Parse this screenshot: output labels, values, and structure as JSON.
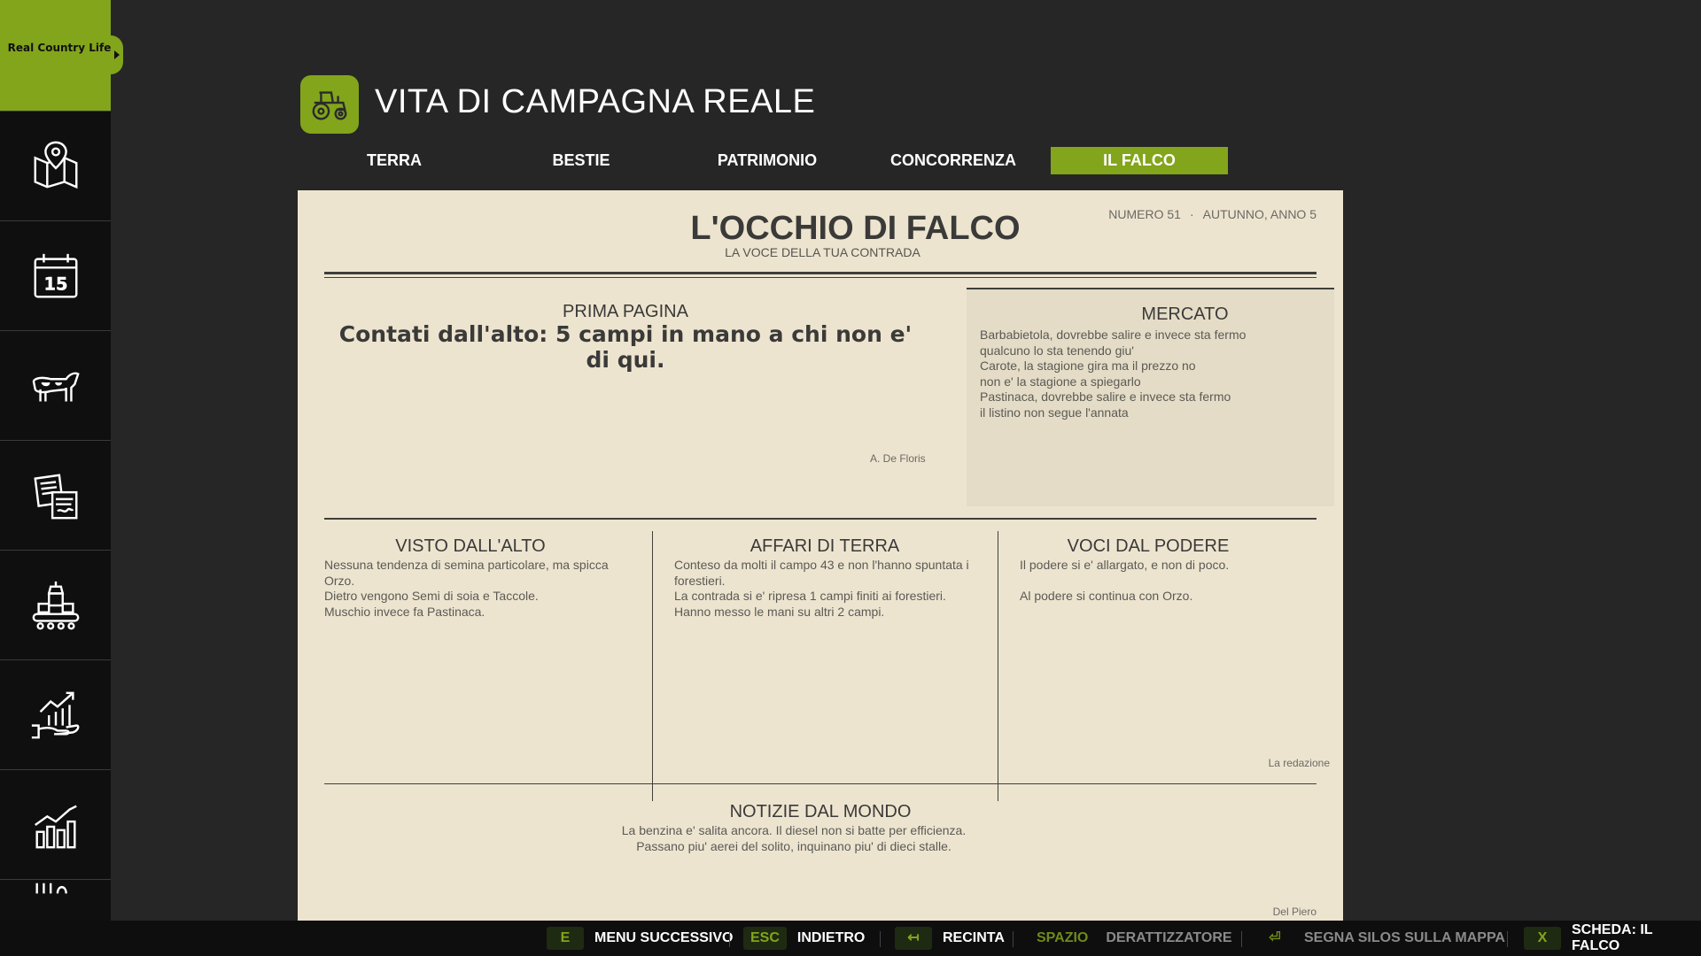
{
  "brand": {
    "logo_text": "Real Country Life",
    "accent": "#82a51b"
  },
  "sidebar": {
    "items": [
      {
        "icon": "map-pin-icon"
      },
      {
        "icon": "calendar-icon",
        "day": "15"
      },
      {
        "icon": "cow-icon"
      },
      {
        "icon": "documents-icon"
      },
      {
        "icon": "production-icon"
      },
      {
        "icon": "finance-growth-icon"
      },
      {
        "icon": "bar-chart-icon"
      },
      {
        "icon": "more-icon"
      }
    ]
  },
  "header": {
    "title": "VITA DI CAMPAGNA REALE",
    "icon": "tractor-icon"
  },
  "tabs": [
    {
      "label": "TERRA",
      "active": false
    },
    {
      "label": "BESTIE",
      "active": false
    },
    {
      "label": "PATRIMONIO",
      "active": false
    },
    {
      "label": "CONCORRENZA",
      "active": false
    },
    {
      "label": "IL FALCO",
      "active": true
    }
  ],
  "newspaper": {
    "title": "L'OCCHIO DI FALCO",
    "tagline": "LA VOCE DELLA TUA CONTRADA",
    "issue_number": "NUMERO 51",
    "issue_season": "AUTUNNO, ANNO 5",
    "front_page": {
      "heading": "PRIMA PAGINA",
      "headline": "Contati dall'alto: 5 campi in mano a chi non e' di qui.",
      "byline": "A. De Floris"
    },
    "market": {
      "heading": "MERCATO",
      "lines": [
        "Barbabietola, dovrebbe salire e invece sta fermo",
        "qualcuno lo sta tenendo giu'",
        "Carote, la stagione gira ma il prezzo no",
        "non e' la stagione a spiegarlo",
        "Pastinaca, dovrebbe salire e invece sta fermo",
        "il listino non segue l'annata"
      ]
    },
    "visto": {
      "heading": "VISTO DALL'ALTO",
      "lines": [
        "Nessuna tendenza di semina particolare, ma spicca",
        "Orzo.",
        "Dietro vengono Semi di soia e Taccole.",
        "Muschio invece fa Pastinaca."
      ]
    },
    "affari": {
      "heading": "AFFARI DI TERRA",
      "lines": [
        "Conteso da molti il campo 43 e non l'hanno spuntata i",
        "forestieri.",
        "La contrada si e' ripresa 1 campi finiti ai forestieri.",
        "Hanno messo le mani su altri 2 campi."
      ]
    },
    "voci": {
      "heading": "VOCI DAL PODERE",
      "lines": [
        "Il podere si e' allargato, e non di poco.",
        "",
        "Al podere si continua con Orzo."
      ],
      "byline": "La redazione"
    },
    "notizie": {
      "heading": "NOTIZIE DAL MONDO",
      "lines": [
        "La benzina e' salita ancora. Il diesel non si batte per efficienza.",
        "Passano piu' aerei del solito, inquinano piu' di dieci stalle."
      ],
      "byline": "Del Piero"
    }
  },
  "bottombar": {
    "hints": [
      {
        "key": "E",
        "label": "MENU SUCCESSIVO"
      },
      {
        "key": "ESC",
        "label": "INDIETRO"
      },
      {
        "key": "↤",
        "label": "RECINTA"
      },
      {
        "key": "SPAZIO",
        "label": "DERATTIZZATORE"
      },
      {
        "key": "⏎",
        "label": "SEGNA SILOS SULLA MAPPA"
      },
      {
        "key": "X",
        "label": "SCHEDA: IL FALCO"
      }
    ]
  }
}
